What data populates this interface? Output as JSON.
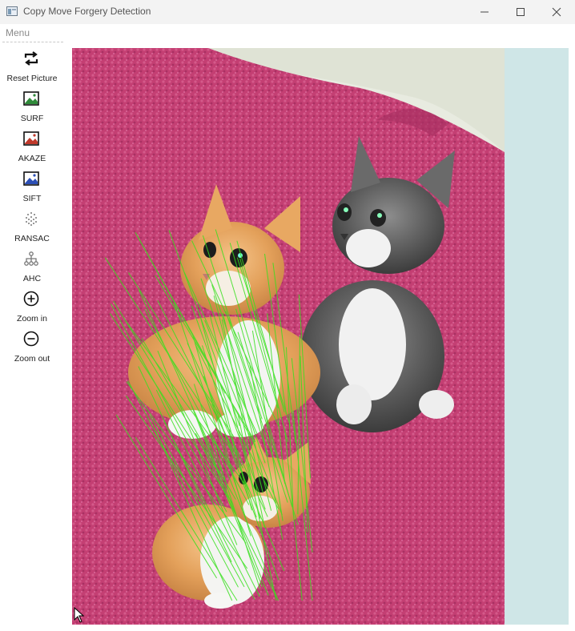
{
  "window": {
    "title": "Copy Move Forgery Detection",
    "controls": [
      "minimize-icon",
      "maximize-icon",
      "close-icon"
    ]
  },
  "menubar": {
    "menu_label": "Menu"
  },
  "toolbar": {
    "items": [
      {
        "label": "Reset Picture",
        "icon": "reset-icon"
      },
      {
        "label": "SURF",
        "icon": "image-icon"
      },
      {
        "label": "AKAZE",
        "icon": "image-icon"
      },
      {
        "label": "SIFT",
        "icon": "image-icon"
      },
      {
        "label": "RANSAC",
        "icon": "scatter-icon"
      },
      {
        "label": "AHC",
        "icon": "hierarchy-icon"
      },
      {
        "label": "Zoom in",
        "icon": "zoom-in-icon"
      },
      {
        "label": "Zoom out",
        "icon": "zoom-out-icon"
      }
    ]
  },
  "image": {
    "subject": "three kittens on pink blanket with green match lines",
    "match_line_color": "#38e01e"
  },
  "colors": {
    "titlebar_bg": "#f3f3f3",
    "canvas_bg": "#cfe6e7",
    "blanket": "#c43f73"
  }
}
